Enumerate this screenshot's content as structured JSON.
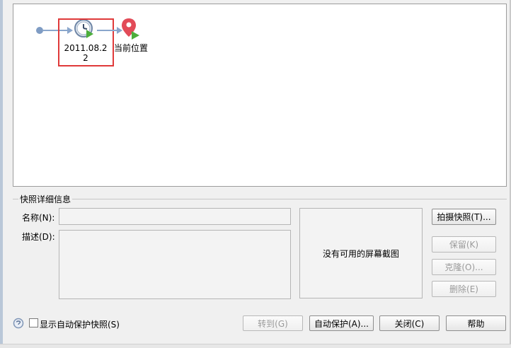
{
  "timeline": {
    "nodes": [
      {
        "label": "2011.08.2\n2",
        "icon": "clock-play-icon"
      },
      {
        "label": "当前位置",
        "icon": "map-pin-play-icon"
      }
    ],
    "selected_index": 0,
    "colors": {
      "line": "#8aa6cc",
      "selection": "#e03a3a",
      "pin": "#e24b58",
      "play": "#4cae3c"
    }
  },
  "details": {
    "group_title": "快照详细信息",
    "name_label": "名称(N):",
    "name_value": "",
    "desc_label": "描述(D):",
    "desc_value": "",
    "preview_text": "没有可用的屏幕截图"
  },
  "actions": {
    "take_snapshot": "拍摄快照(T)...",
    "keep": "保留(K)",
    "clone": "克隆(O)...",
    "delete": "删除(E)"
  },
  "footer": {
    "show_autoprotect_label": "显示自动保护快照(S)",
    "show_autoprotect_checked": false,
    "goto": "转到(G)",
    "autoprotect": "自动保护(A)...",
    "close": "关闭(C)",
    "help": "帮助"
  }
}
